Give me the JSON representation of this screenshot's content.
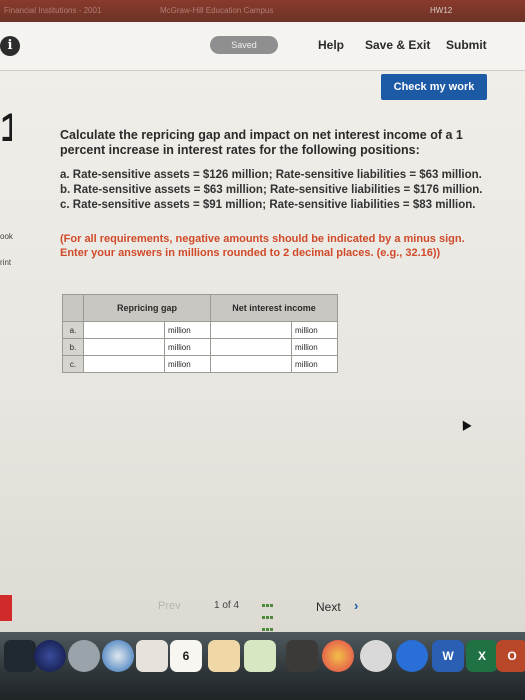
{
  "browser": {
    "tab_left": "Financial Institutions - 2001",
    "tab_mid": "McGraw-Hill Education Campus",
    "tab_right": "HW12"
  },
  "toolbar": {
    "saved_label": "Saved",
    "help_label": "Help",
    "save_exit_label": "Save & Exit",
    "submit_label": "Submit",
    "check_label": "Check my work"
  },
  "question": {
    "number": "1",
    "prompt": "Calculate the repricing gap and impact on net interest income of a 1 percent increase in interest rates for the following positions:",
    "positions": [
      "a. Rate-sensitive assets = $126 million; Rate-sensitive liabilities = $63 million.",
      "b. Rate-sensitive assets = $63 million; Rate-sensitive liabilities = $176 million.",
      "c. Rate-sensitive assets = $91 million; Rate-sensitive liabilities = $83 million."
    ],
    "instruction": "(For all requirements, negative amounts should be indicated by a minus sign. Enter your answers in millions rounded to 2 decimal places. (e.g., 32.16))"
  },
  "sidebar": {
    "book_label": "ook",
    "print_label": "rint"
  },
  "table": {
    "headers": [
      "Repricing gap",
      "Net interest income"
    ],
    "rows": [
      {
        "label": "a.",
        "gap_value": "",
        "gap_unit": "million",
        "nii_value": "",
        "nii_unit": "million"
      },
      {
        "label": "b.",
        "gap_value": "",
        "gap_unit": "million",
        "nii_value": "",
        "nii_unit": "million"
      },
      {
        "label": "c.",
        "gap_value": "",
        "gap_unit": "million",
        "nii_value": "",
        "nii_unit": "million"
      }
    ]
  },
  "pager": {
    "prev_label": "Prev",
    "current": "1",
    "of_label": "of 4",
    "next_label": "Next"
  },
  "dock": {
    "calendar_day": "6",
    "word_label": "W",
    "excel_label": "X",
    "outlook_label": "O"
  }
}
